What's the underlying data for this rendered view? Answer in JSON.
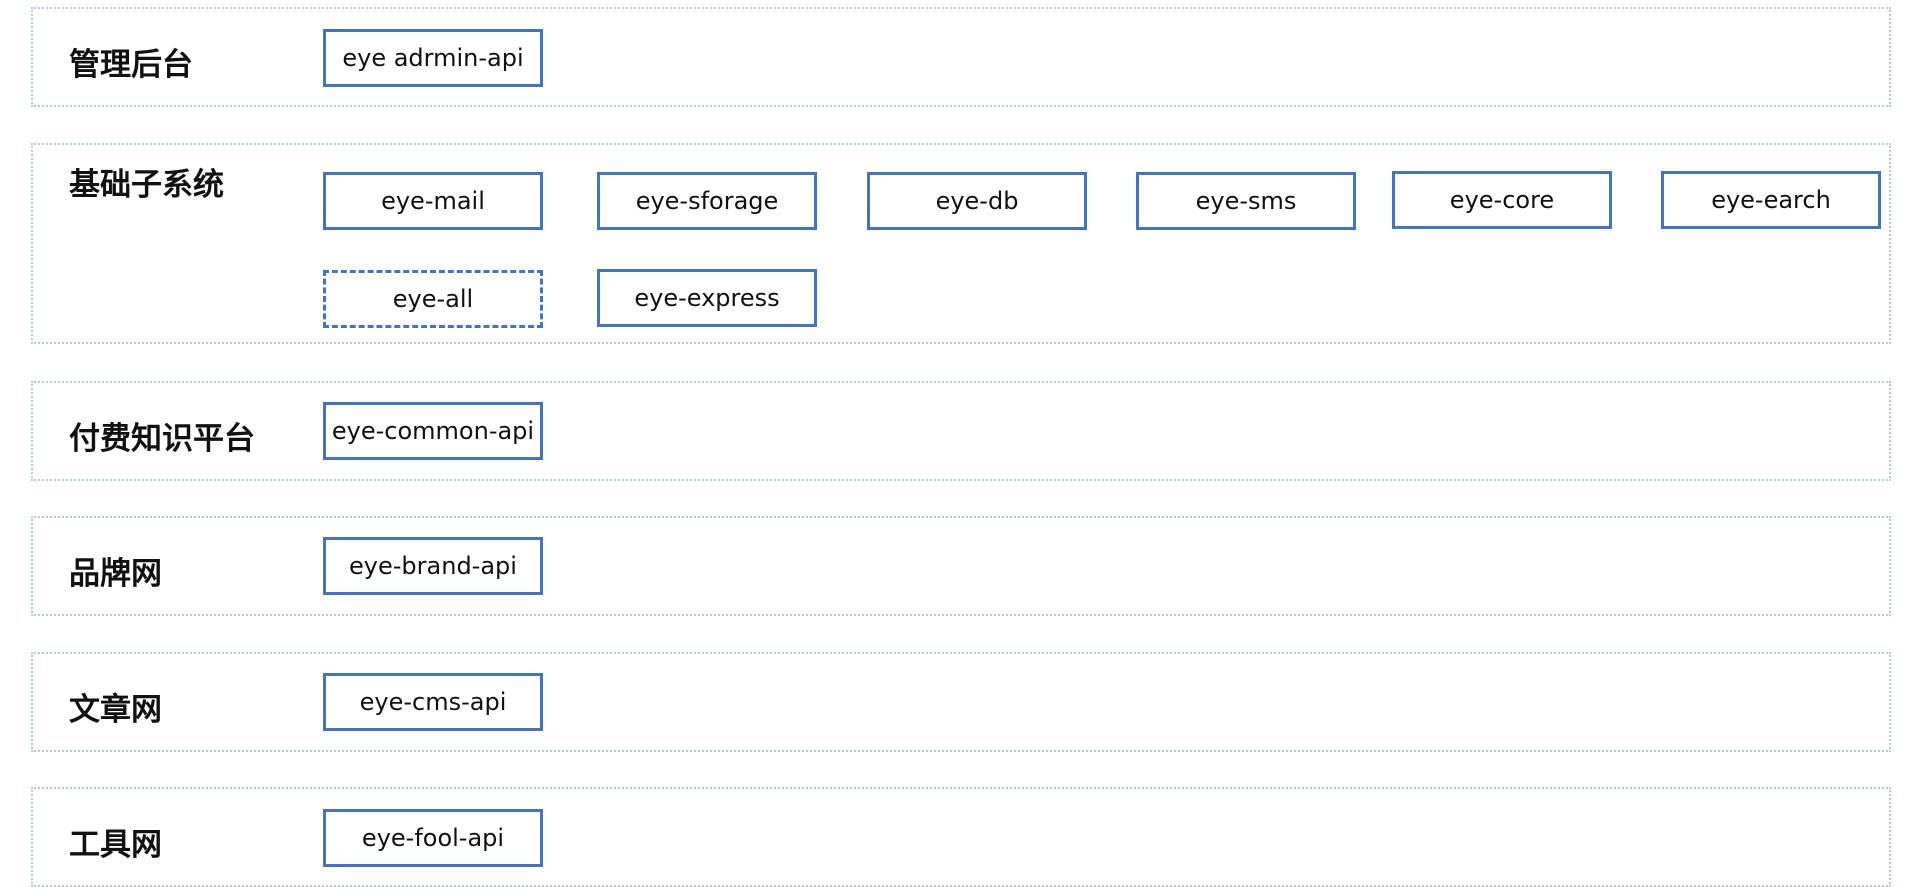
{
  "sections": [
    {
      "title": "管理后台",
      "modules": [
        "eye adrmin-api"
      ]
    },
    {
      "title": "基础子系统",
      "modules": [
        "eye-mail",
        "eye-sforage",
        "eye-db",
        "eye-sms",
        "eye-core",
        "eye-earch",
        "eye-all",
        "eye-express"
      ]
    },
    {
      "title": "付费知识平台",
      "modules": [
        "eye-common-api"
      ]
    },
    {
      "title": "品牌网",
      "modules": [
        "eye-brand-api"
      ]
    },
    {
      "title": "文章网",
      "modules": [
        "eye-cms-api"
      ]
    },
    {
      "title": "工具网",
      "modules": [
        "eye-fool-api"
      ]
    }
  ],
  "colors": {
    "box_border": "#4472c4",
    "section_border": "#b8c8e8"
  }
}
